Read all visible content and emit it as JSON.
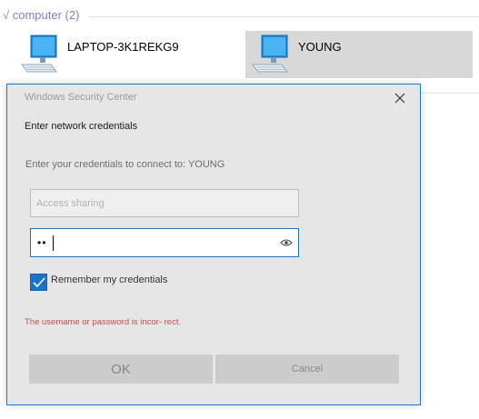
{
  "explorer": {
    "group_header": "√ computer (2)",
    "devices": [
      {
        "name": "LAPTOP-3K1REKG9",
        "icon": "computer-icon",
        "selected": false
      },
      {
        "name": "YOUNG",
        "icon": "computer-icon",
        "selected": true
      }
    ]
  },
  "dialog": {
    "title": "Windows Security Center",
    "close_icon": "close-icon",
    "heading": "Enter network credentials",
    "prompt": "Enter your credentials to connect to: YOUNG",
    "username": {
      "value": "",
      "placeholder": "Access sharing"
    },
    "password": {
      "masked_value": "••",
      "reveal_icon": "eye-icon"
    },
    "remember": {
      "label": "Remember my credentials",
      "checked": true
    },
    "error": "The usemame or password is incor- rect.",
    "buttons": {
      "ok": "OK",
      "cancel": "Cancel"
    }
  },
  "colors": {
    "accent": "#1b73c8",
    "error": "#c0504d",
    "dialog_bg": "#e6e6e6",
    "selected_bg": "#d8d8d8",
    "group_header": "#7f7fc8"
  }
}
